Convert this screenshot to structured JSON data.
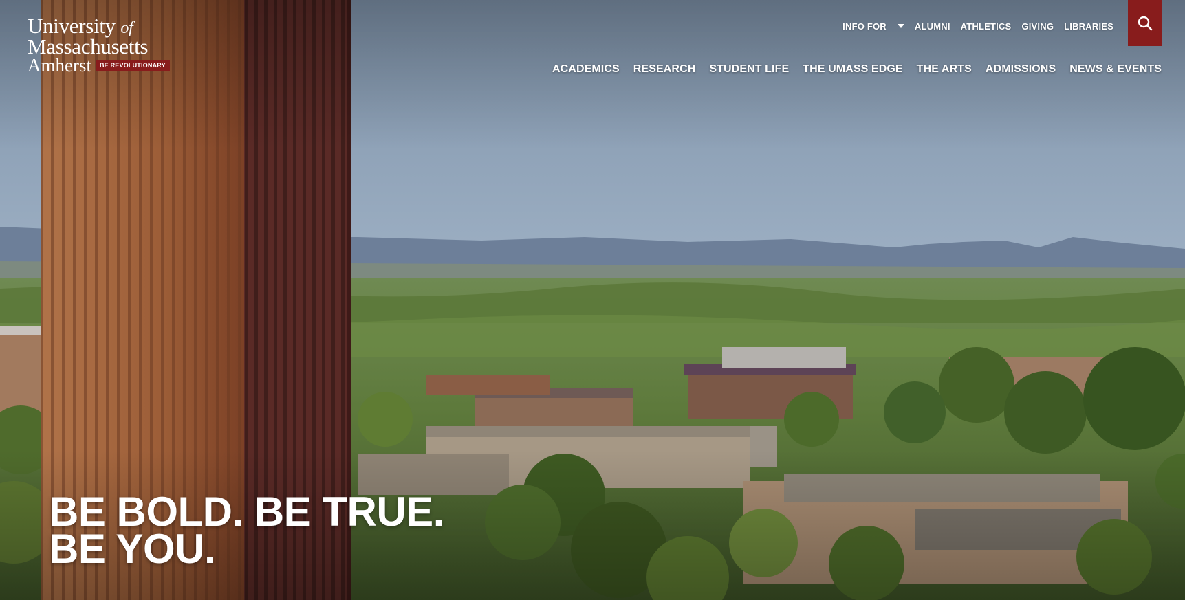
{
  "logo": {
    "line1": "University",
    "line1_of": "of",
    "line2": "Massachusetts",
    "line3": "Amherst",
    "badge": "BE REVOLUTIONARY"
  },
  "utility_nav": {
    "info_for": "INFO FOR",
    "items": [
      "ALUMNI",
      "ATHLETICS",
      "GIVING",
      "LIBRARIES"
    ]
  },
  "main_nav": {
    "items": [
      "ACADEMICS",
      "RESEARCH",
      "STUDENT LIFE",
      "THE UMASS EDGE",
      "THE ARTS",
      "ADMISSIONS",
      "NEWS & EVENTS"
    ]
  },
  "hero": {
    "line1": "BE BOLD. BE TRUE.",
    "line2": "BE YOU."
  },
  "colors": {
    "maroon": "#881c1c",
    "sky": "#9aaec4",
    "foliage": "#5f7a3c",
    "tower": "#a7673f"
  },
  "icons": [
    "search-icon",
    "caret-down-icon"
  ]
}
